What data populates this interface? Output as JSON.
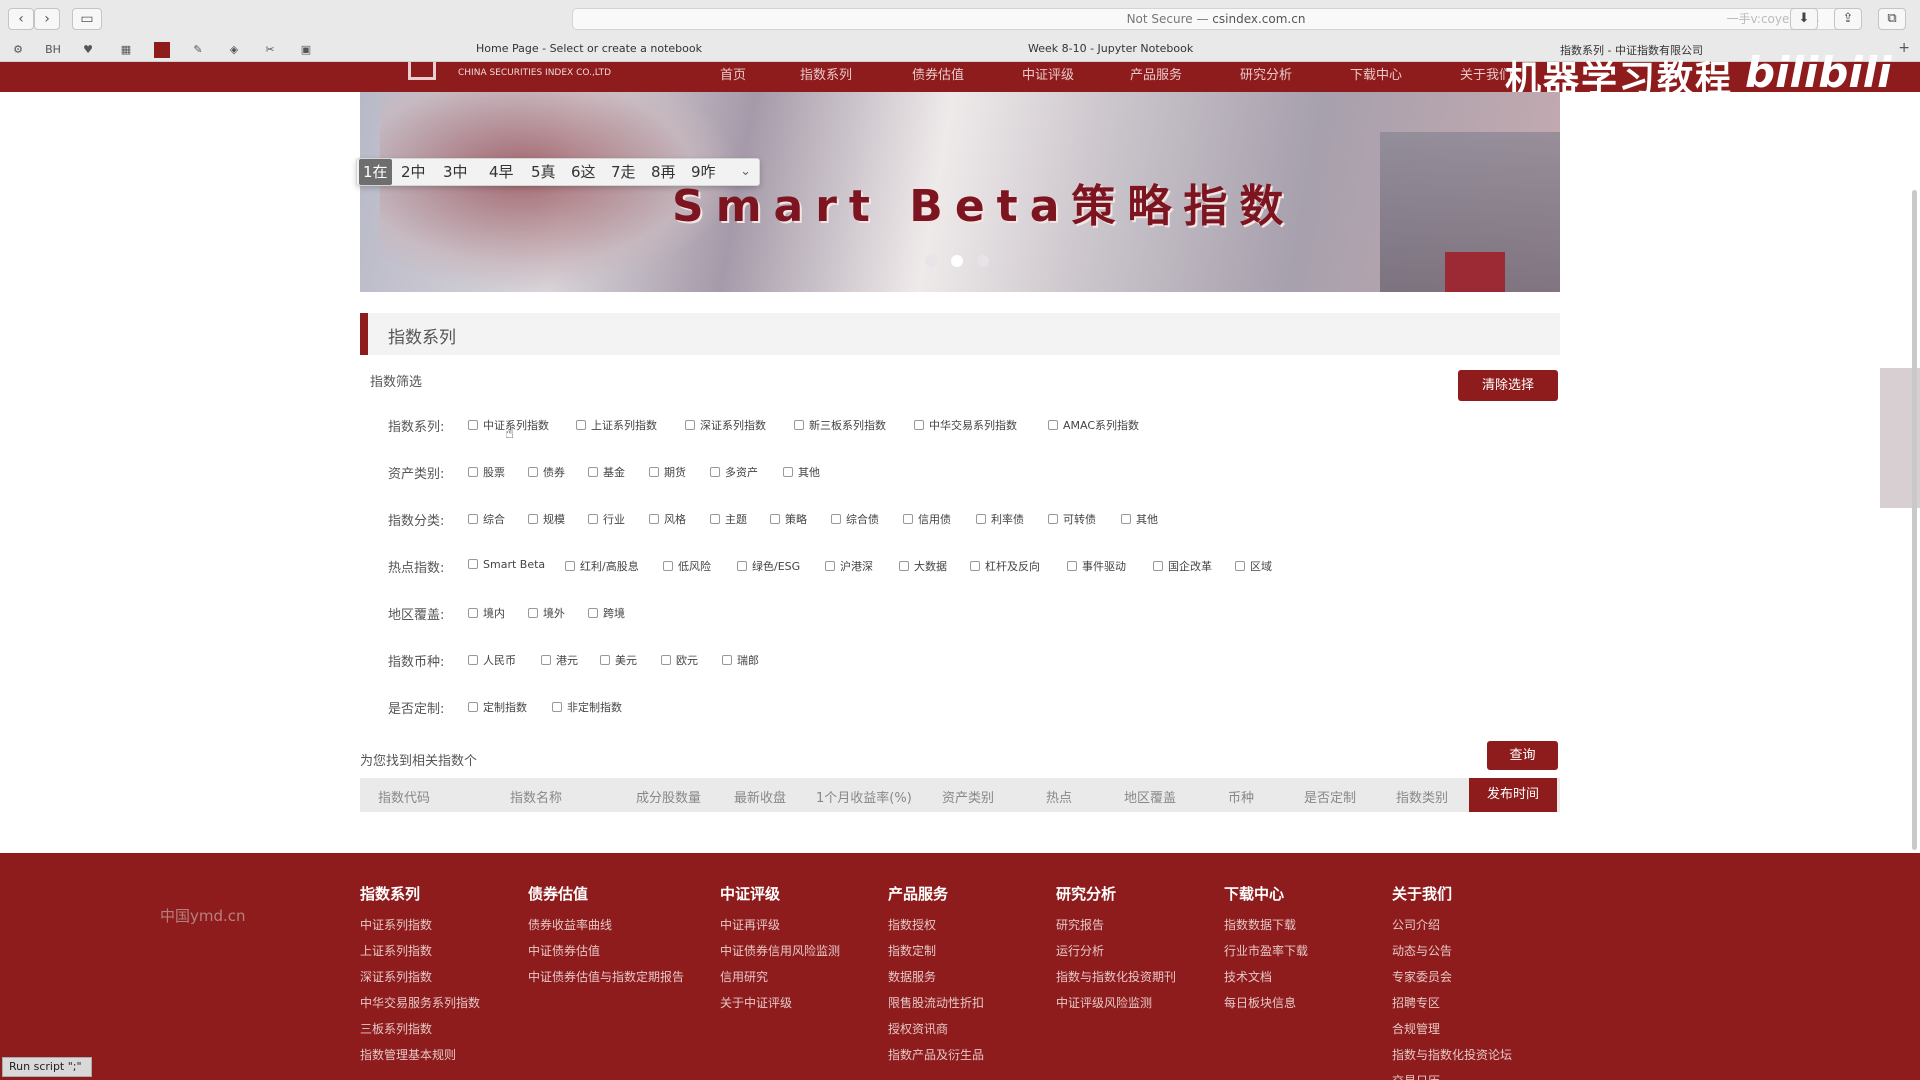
{
  "browser": {
    "address": {
      "prefix": "Not Secure — ",
      "domain": "csindex.com.cn"
    },
    "tabs": [
      "Home Page - Select or create a notebook",
      "Week 8-10 - Jupyter Notebook",
      "指数系列 - 中证指数有限公司"
    ],
    "bookmark_icons": [
      "BH"
    ],
    "address_overlay": "一手v:coyerrecs"
  },
  "site": {
    "logo_en": "CHINA SECURITIES INDEX CO.,LTD",
    "nav": [
      "首页",
      "指数系列",
      "债券估值",
      "中证评级",
      "产品服务",
      "研究分析",
      "下载中心",
      "关于我们"
    ]
  },
  "watermark": {
    "text": "机器学习教程",
    "bili": "bilibili"
  },
  "banner": {
    "title": "Smart Beta策略指数"
  },
  "ime": {
    "candidates": [
      "1在",
      "2中",
      "3中",
      "4早",
      "5真",
      "6这",
      "7走",
      "8再",
      "9咋"
    ],
    "selected_index": 0
  },
  "section": {
    "title": "指数系列",
    "filter_title": "指数筛选",
    "clear_label": "清除选择",
    "rows": [
      {
        "label": "指数系列:",
        "options": [
          "中证系列指数",
          "上证系列指数",
          "深证系列指数",
          "新三板系列指数",
          "中华交易系列指数",
          "AMAC系列指数"
        ]
      },
      {
        "label": "资产类别:",
        "options": [
          "股票",
          "债券",
          "基金",
          "期货",
          "多资产",
          "其他"
        ]
      },
      {
        "label": "指数分类:",
        "options": [
          "综合",
          "规模",
          "行业",
          "风格",
          "主题",
          "策略",
          "综合债",
          "信用债",
          "利率债",
          "可转债",
          "其他"
        ]
      },
      {
        "label": "热点指数:",
        "options": [
          "Smart Beta",
          "红利/高股息",
          "低风险",
          "绿色/ESG",
          "沪港深",
          "大数据",
          "杠杆及反向",
          "事件驱动",
          "国企改革",
          "区域"
        ]
      },
      {
        "label": "地区覆盖:",
        "options": [
          "境内",
          "境外",
          "跨境"
        ]
      },
      {
        "label": "指数币种:",
        "options": [
          "人民币",
          "港元",
          "美元",
          "欧元",
          "瑞郎"
        ]
      },
      {
        "label": "是否定制:",
        "options": [
          "定制指数",
          "非定制指数"
        ]
      }
    ],
    "found_text": "为您找到相关指数个",
    "query_label": "查询",
    "table_headers": [
      "指数代码",
      "指数名称",
      "成分股数量",
      "最新收盘",
      "1个月收益率(%)",
      "资产类别",
      "热点",
      "地区覆盖",
      "币种",
      "是否定制",
      "指数类别",
      "发布时间"
    ]
  },
  "footer": {
    "side_text": "中国ymd.cn",
    "columns": [
      {
        "title": "指数系列",
        "items": [
          "中证系列指数",
          "上证系列指数",
          "深证系列指数",
          "中华交易服务系列指数",
          "三板系列指数",
          "指数管理基本规则"
        ]
      },
      {
        "title": "债券估值",
        "items": [
          "债券收益率曲线",
          "中证债券估值",
          "中证债券估值与指数定期报告"
        ]
      },
      {
        "title": "中证评级",
        "items": [
          "中证再评级",
          "中证债券信用风险监测",
          "信用研究",
          "关于中证评级"
        ]
      },
      {
        "title": "产品服务",
        "items": [
          "指数授权",
          "指数定制",
          "数据服务",
          "限售股流动性折扣",
          "授权资讯商",
          "指数产品及衍生品"
        ]
      },
      {
        "title": "研究分析",
        "items": [
          "研究报告",
          "运行分析",
          "指数与指数化投资期刊",
          "中证评级风险监测"
        ]
      },
      {
        "title": "下载中心",
        "items": [
          "指数数据下载",
          "行业市盈率下载",
          "技术文档",
          "每日板块信息"
        ]
      },
      {
        "title": "关于我们",
        "items": [
          "公司介绍",
          "动态与公告",
          "专家委员会",
          "招聘专区",
          "合规管理",
          "指数与指数化投资论坛",
          "交易日历"
        ]
      }
    ]
  },
  "run_script": "Run script \";\""
}
